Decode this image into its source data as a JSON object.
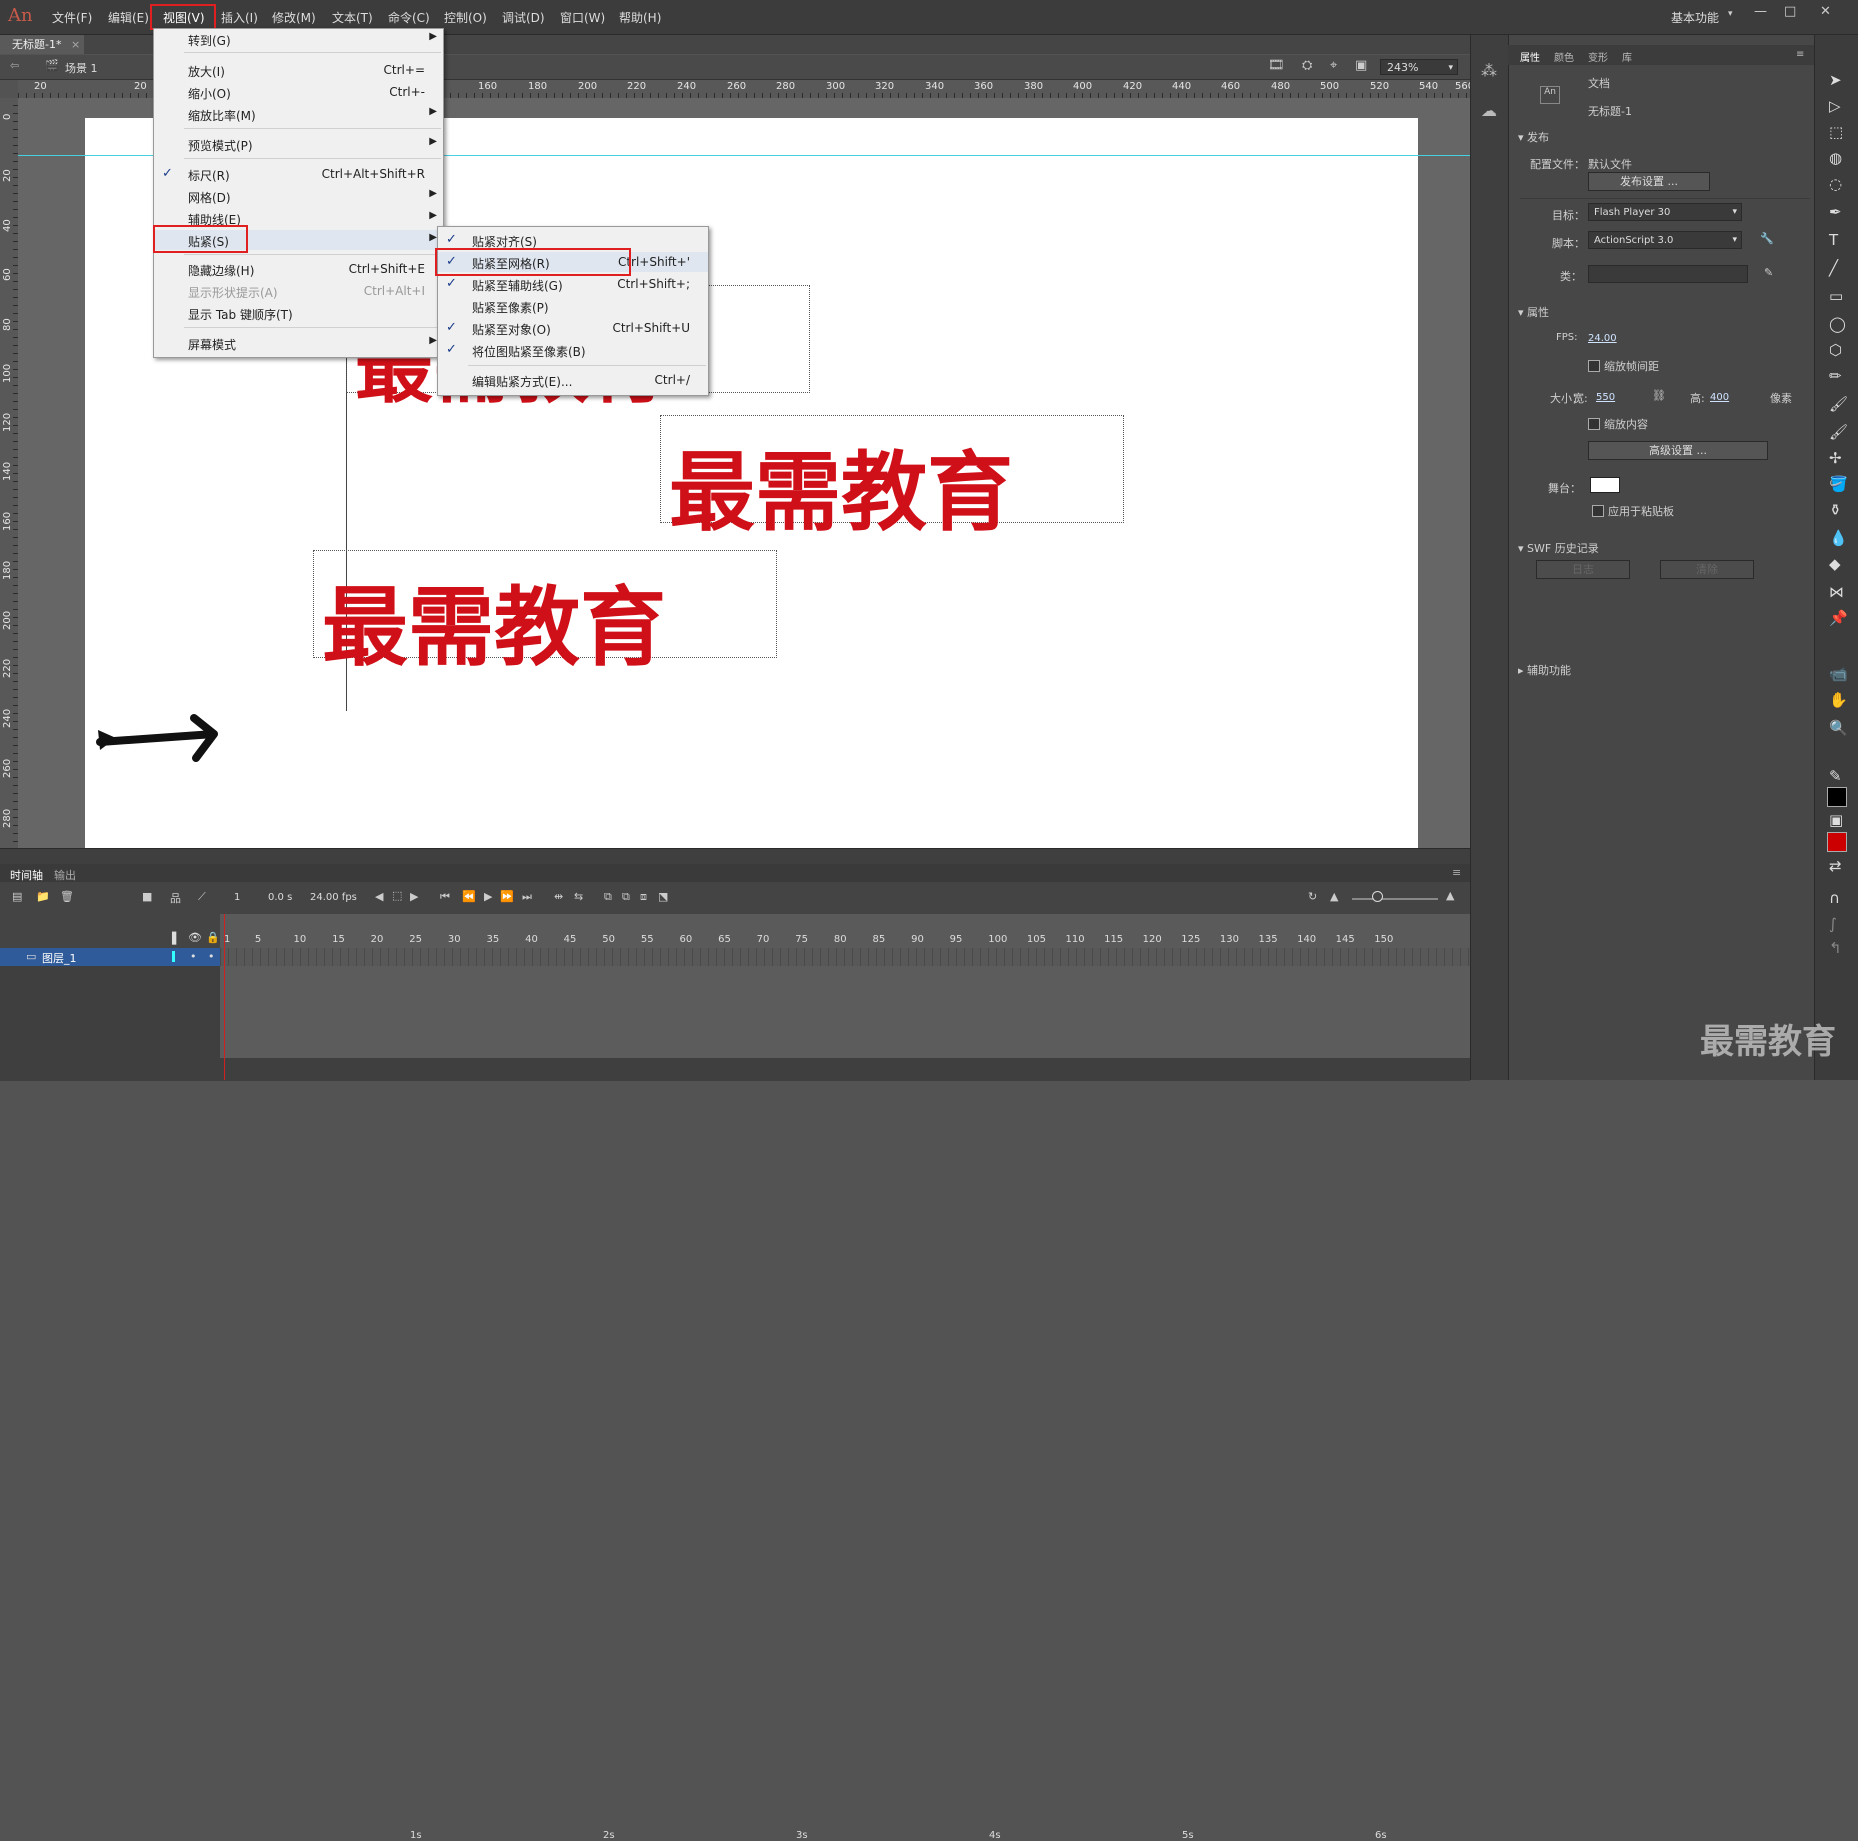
{
  "app": {
    "logo": "An"
  },
  "menubar": {
    "items": [
      "文件(F)",
      "编辑(E)",
      "视图(V)",
      "插入(I)",
      "修改(M)",
      "文本(T)",
      "命令(C)",
      "控制(O)",
      "调试(D)",
      "窗口(W)",
      "帮助(H)"
    ],
    "active": "视图(V)",
    "workspace": "基本功能"
  },
  "doc_tab": {
    "title": "无标题-1*"
  },
  "scene": {
    "label": "场景 1",
    "zoom": "243%"
  },
  "ruler_top": [
    "20",
    "20",
    "160",
    "180",
    "200",
    "220",
    "240",
    "260",
    "280",
    "300",
    "320",
    "340",
    "360",
    "380",
    "400",
    "420",
    "440",
    "460",
    "480",
    "500",
    "520",
    "540",
    "560"
  ],
  "ruler_left": [
    "0",
    "20",
    "40",
    "60",
    "80",
    "100",
    "120",
    "140",
    "160",
    "180",
    "200",
    "220",
    "240",
    "260",
    "280"
  ],
  "stage": {
    "texts": [
      "最需教育",
      "最需教育",
      "最需教育"
    ]
  },
  "view_menu": {
    "items": [
      {
        "label": "转到(G)",
        "shortcut": "",
        "submenu": true
      },
      {
        "label": "放大(I)",
        "shortcut": "Ctrl+="
      },
      {
        "label": "缩小(O)",
        "shortcut": "Ctrl+-"
      },
      {
        "label": "缩放比率(M)",
        "shortcut": "",
        "submenu": true
      },
      {
        "label": "预览模式(P)",
        "shortcut": "",
        "submenu": true
      },
      {
        "label": "标尺(R)",
        "shortcut": "Ctrl+Alt+Shift+R",
        "checked": true
      },
      {
        "label": "网格(D)",
        "shortcut": "",
        "submenu": true
      },
      {
        "label": "辅助线(E)",
        "shortcut": "",
        "submenu": true
      },
      {
        "label": "贴紧(S)",
        "shortcut": "",
        "submenu": true,
        "highlighted": true
      },
      {
        "label": "隐藏边缘(H)",
        "shortcut": "Ctrl+Shift+E"
      },
      {
        "label": "显示形状提示(A)",
        "shortcut": "Ctrl+Alt+I",
        "disabled": true
      },
      {
        "label": "显示 Tab 键顺序(T)",
        "shortcut": ""
      },
      {
        "label": "屏幕模式",
        "shortcut": "",
        "submenu": true
      }
    ]
  },
  "snap_submenu": {
    "items": [
      {
        "label": "贴紧对齐(S)",
        "shortcut": "",
        "checked": true
      },
      {
        "label": "贴紧至网格(R)",
        "shortcut": "Ctrl+Shift+'",
        "checked": true,
        "highlighted": true
      },
      {
        "label": "贴紧至辅助线(G)",
        "shortcut": "Ctrl+Shift+;",
        "checked": true
      },
      {
        "label": "贴紧至像素(P)",
        "shortcut": ""
      },
      {
        "label": "贴紧至对象(O)",
        "shortcut": "Ctrl+Shift+U",
        "checked": true
      },
      {
        "label": "将位图贴紧至像素(B)",
        "shortcut": "",
        "checked": true
      },
      {
        "label": "编辑贴紧方式(E)...",
        "shortcut": "Ctrl+/"
      }
    ]
  },
  "properties": {
    "tabs": [
      "属性",
      "颜色",
      "变形",
      "库"
    ],
    "doc_type": "文档",
    "doc_name": "无标题-1",
    "publish_section": "发布",
    "profile_label": "配置文件：",
    "profile_value": "默认文件",
    "publish_settings": "发布设置 ...",
    "target_label": "目标：",
    "target_value": "Flash Player 30",
    "script_label": "脚本：",
    "script_value": "ActionScript 3.0",
    "class_label": "类：",
    "props_section": "属性",
    "fps_label": "FPS:",
    "fps_value": "24.00",
    "scale_spacing": "缩放帧间距",
    "size_label": "大小：",
    "width_label": "宽:",
    "width_value": "550",
    "height_label": "高:",
    "height_value": "400",
    "unit": "像素",
    "scale_content": "缩放内容",
    "advanced": "高级设置 ...",
    "stage_label": "舞台：",
    "apply_clipboard": "应用于粘贴板",
    "swf_section": "SWF 历史记录",
    "log_btn": "日志",
    "clear_btn": "清除",
    "accessibility_section": "辅助功能"
  },
  "timeline": {
    "tabs": [
      "时间轴",
      "输出"
    ],
    "frame": "1",
    "time": "0.0 s",
    "fps": "24.00 fps",
    "layer": "图层_1",
    "seconds": [
      "1s",
      "2s",
      "3s",
      "4s",
      "5s",
      "6s"
    ],
    "frame_numbers": [
      "1",
      "5",
      "10",
      "15",
      "20",
      "25",
      "30",
      "35",
      "40",
      "45",
      "50",
      "55",
      "60",
      "65",
      "70",
      "75",
      "80",
      "85",
      "90",
      "95",
      "100",
      "105",
      "110",
      "115",
      "120",
      "125",
      "130",
      "135",
      "140",
      "145",
      "150"
    ]
  },
  "watermark": "最需教育",
  "colors": {
    "accent_red": "#e02020",
    "stage_text": "#d01018",
    "guide": "#47d0e0"
  }
}
